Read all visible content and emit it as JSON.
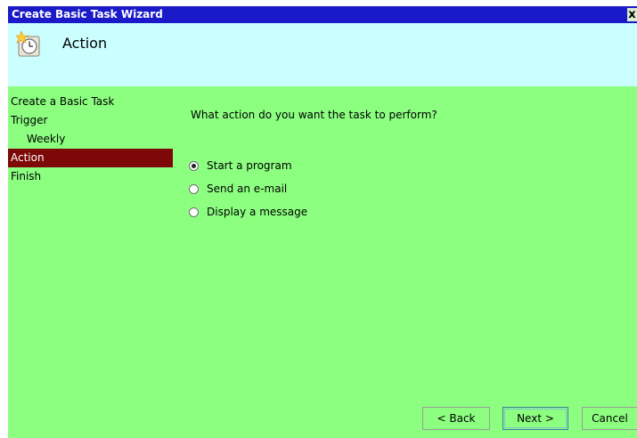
{
  "window": {
    "title": "Create Basic Task Wizard",
    "close_label": "x"
  },
  "header": {
    "title": "Action",
    "icon": "task-scheduler-clock-icon"
  },
  "nav": {
    "items": [
      {
        "label": "Create a Basic Task",
        "active": false
      },
      {
        "label": "Trigger",
        "active": false
      },
      {
        "label": "Weekly",
        "active": false
      },
      {
        "label": "Action",
        "active": true
      },
      {
        "label": "Finish",
        "active": false
      }
    ]
  },
  "main": {
    "question": "What action do you want the task to perform?",
    "options": [
      {
        "label": "Start a program",
        "selected": true
      },
      {
        "label": "Send an e-mail",
        "selected": false
      },
      {
        "label": "Display a message",
        "selected": false
      }
    ]
  },
  "buttons": {
    "back": "< Back",
    "next": "Next >",
    "cancel": "Cancel"
  },
  "colors": {
    "titlebar": "#1a1ac8",
    "header_bg": "#cbffff",
    "body_bg": "#8cff80",
    "active_nav": "#7d0808"
  }
}
